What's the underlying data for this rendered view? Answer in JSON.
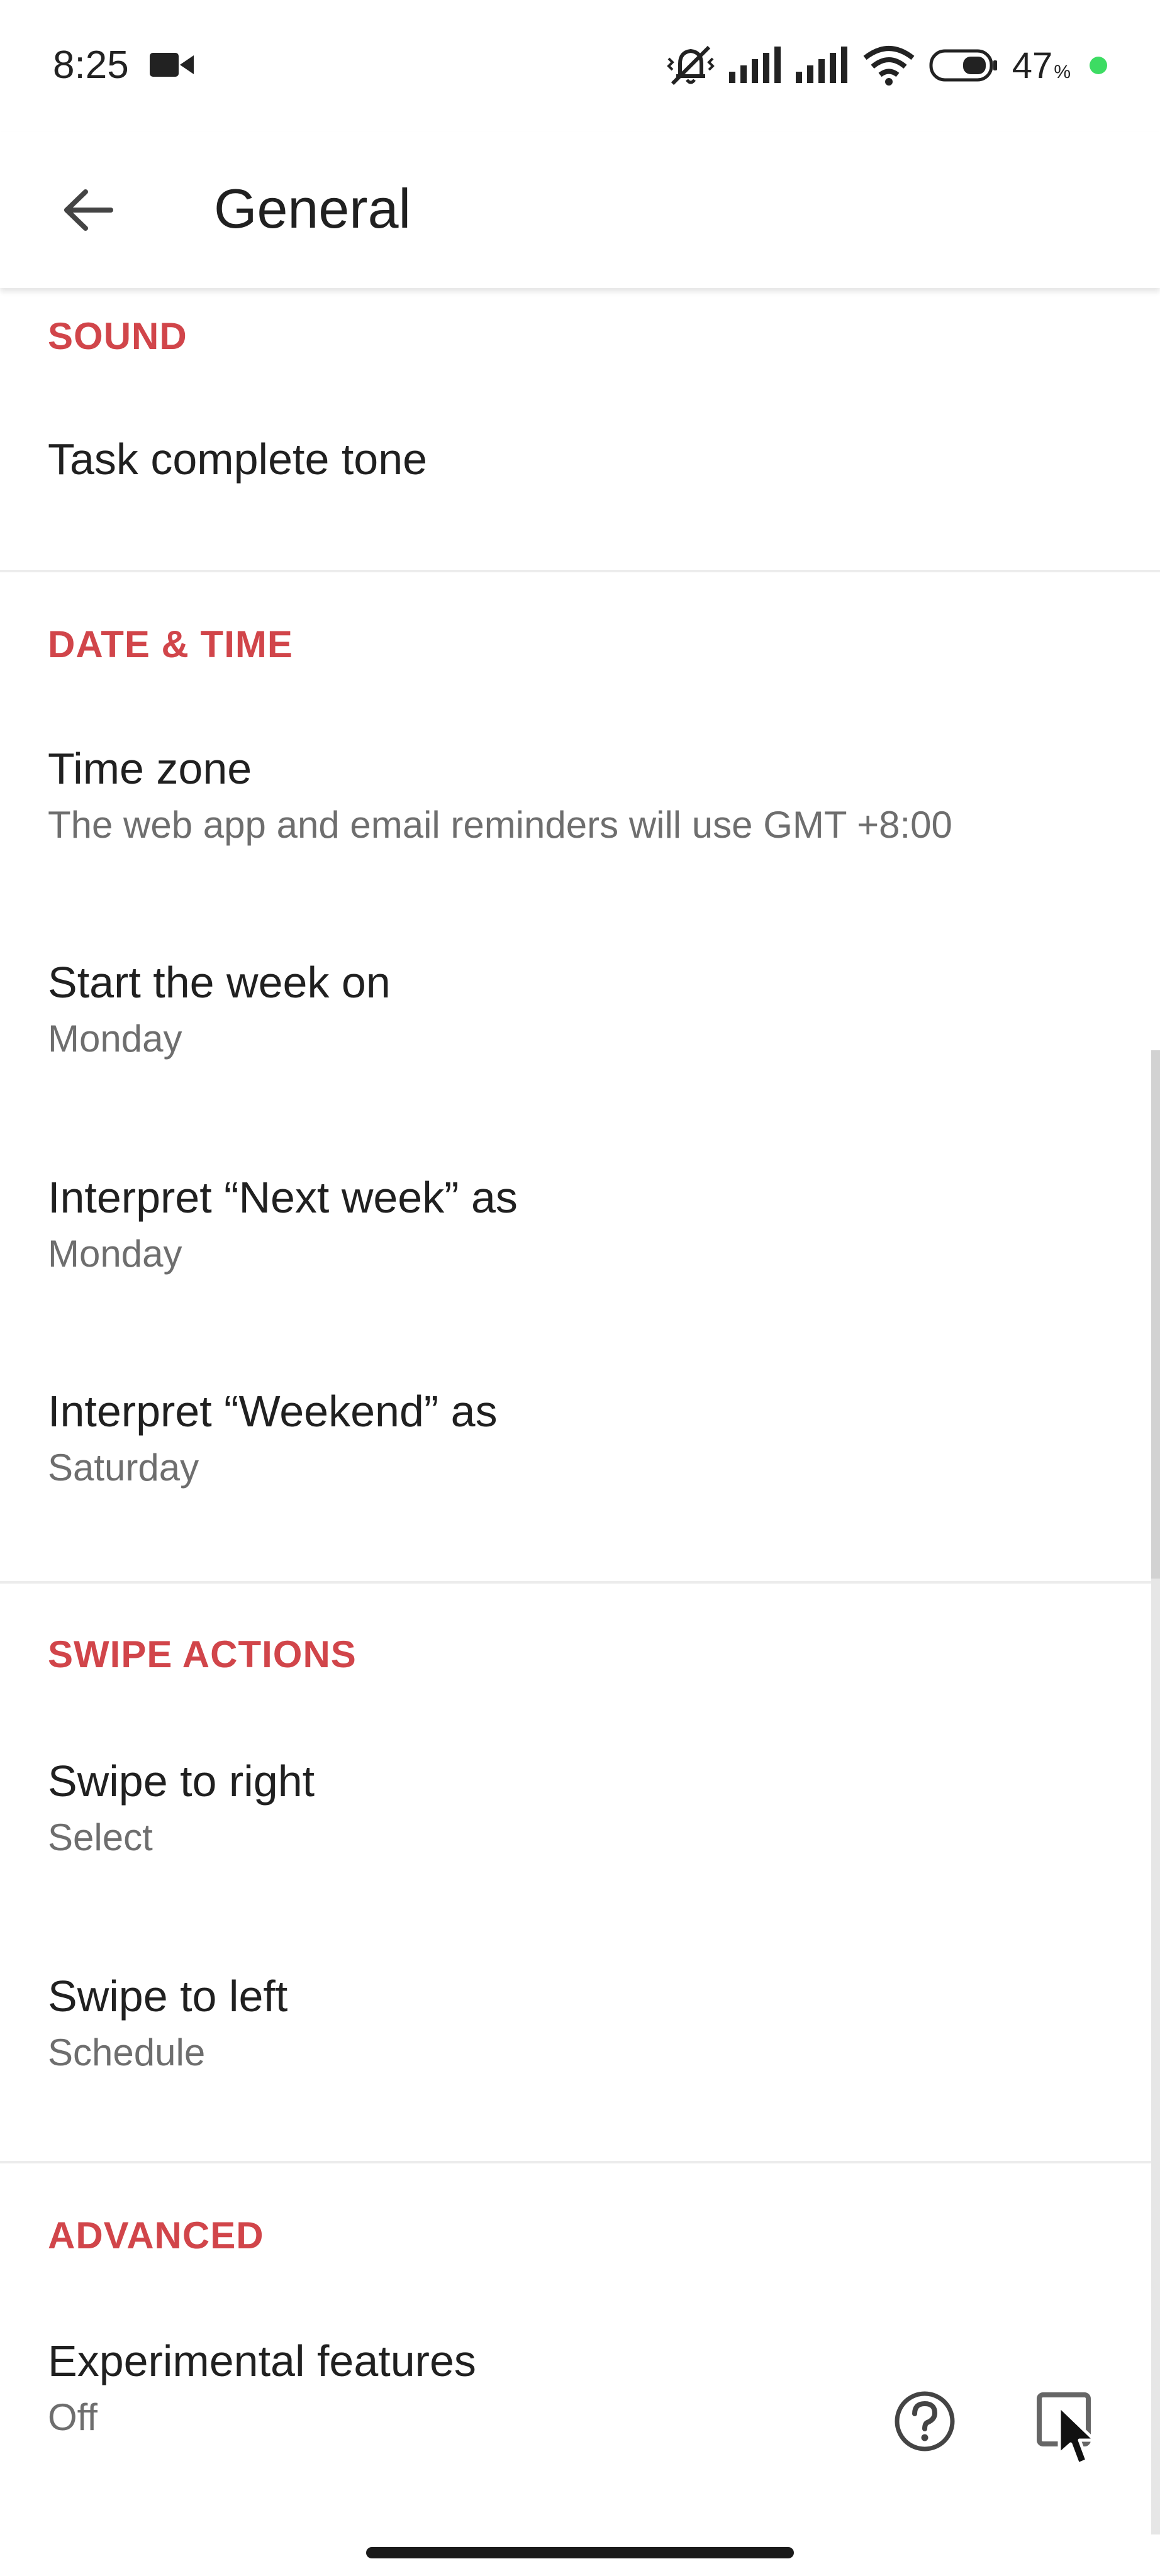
{
  "status_bar": {
    "time": "8:25",
    "battery_percent": "47",
    "battery_unit": "%",
    "icons": [
      "video-camera-icon",
      "mute-vibrate-icon",
      "signal-icon",
      "signal-icon",
      "wifi-icon",
      "battery-icon"
    ]
  },
  "app_bar": {
    "title": "General",
    "back_icon": "arrow-left-icon"
  },
  "sections": {
    "sound": {
      "header": "SOUND",
      "task_complete_tone": {
        "title": "Task complete tone"
      }
    },
    "date_time": {
      "header": "DATE & TIME",
      "time_zone": {
        "title": "Time zone",
        "value": "The web app and email reminders will use GMT +8:00"
      },
      "start_week": {
        "title": "Start the week on",
        "value": "Monday"
      },
      "next_week": {
        "title": "Interpret “Next week” as",
        "value": "Monday"
      },
      "weekend": {
        "title": "Interpret “Weekend” as",
        "value": "Saturday"
      }
    },
    "swipe_actions": {
      "header": "SWIPE ACTIONS",
      "swipe_right": {
        "title": "Swipe to right",
        "value": "Select"
      },
      "swipe_left": {
        "title": "Swipe to left",
        "value": "Schedule"
      }
    },
    "advanced": {
      "header": "ADVANCED",
      "experimental": {
        "title": "Experimental features",
        "value": "Off"
      }
    }
  },
  "colors": {
    "accent": "#d1454a",
    "text_primary": "#202020",
    "text_secondary": "#6e6e6e",
    "status_dot": "#3ddc63"
  }
}
